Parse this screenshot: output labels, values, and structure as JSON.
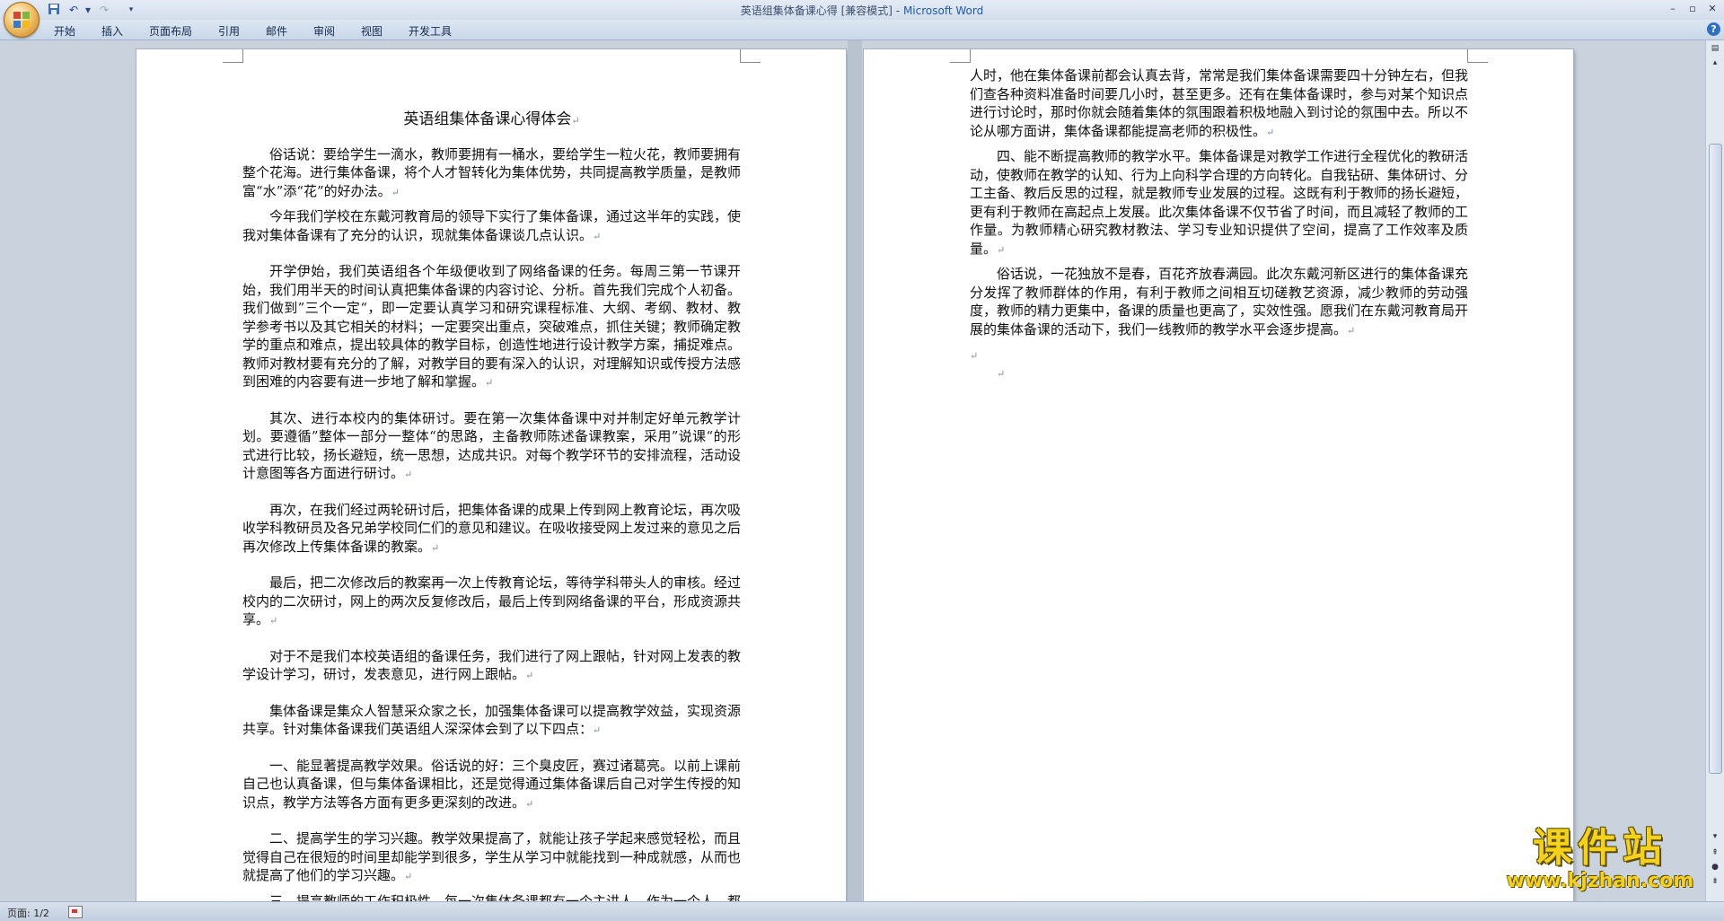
{
  "window": {
    "title": "英语组集体备课心得 [兼容模式]",
    "app_name": "Microsoft Word",
    "title_separator": " - "
  },
  "quick_access": {
    "save_icon": "save-icon",
    "undo_icon": "undo-icon",
    "redo_icon": "redo-icon",
    "customize_icon": "dropdown-icon"
  },
  "ribbon": {
    "tabs": [
      "开始",
      "插入",
      "页面布局",
      "引用",
      "邮件",
      "审阅",
      "视图",
      "开发工具"
    ]
  },
  "paragraph_mark": "↵",
  "document": {
    "title": "英语组集体备课心得体会",
    "page1": [
      "俗话说：要给学生一滴水，教师要拥有一桶水，要给学生一粒火花，教师要拥有整个花海。进行集体备课，将个人才智转化为集体优势，共同提高教学质量，是教师富“水”添“花”的好办法。",
      "今年我们学校在东戴河教育局的领导下实行了集体备课，通过这半年的实践，使我对集体备课有了充分的认识，现就集体备课谈几点认识。",
      "开学伊始，我们英语组各个年级便收到了网络备课的任务。每周三第一节课开始，我们用半天的时间认真把集体备课的内容讨论、分析。首先我们完成个人初备。我们做到”三个一定“，即一定要认真学习和研究课程标准、大纲、考纲、教材、教学参考书以及其它相关的材料；一定要突出重点，突破难点，抓住关键；教师确定教学的重点和难点，提出较具体的教学目标，创造性地进行设计教学方案，捕捉难点。教师对教材要有充分的了解，对教学目的要有深入的认识，对理解知识或传授方法感到困难的内容要有进一步地了解和掌握。",
      "其次、进行本校内的集体研讨。要在第一次集体备课中对并制定好单元教学计划。要遵循”整体一部分一整体“的思路，主备教师陈述备课教案，采用”说课“的形式进行比较，扬长避短，统一思想，达成共识。对每个教学环节的安排流程，活动设计意图等各方面进行研讨。",
      "再次，在我们经过两轮研讨后，把集体备课的成果上传到网上教育论坛，再次吸收学科教研员及各兄弟学校同仁们的意见和建议。在吸收接受网上发过来的意见之后再次修改上传集体备课的教案。",
      "最后，把二次修改后的教案再一次上传教育论坛，等待学科带头人的审核。经过校内的二次研讨，网上的两次反复修改后，最后上传到网络备课的平台，形成资源共享。",
      "对于不是我们本校英语组的备课任务，我们进行了网上跟帖，针对网上发表的教学设计学习，研讨，发表意见，进行网上跟帖。",
      "集体备课是集众人智慧采众家之长，加强集体备课可以提高教学效益，实现资源共享。针对集体备课我们英语组人深深体会到了以下四点：",
      "一、能显著提高教学效果。俗话说的好：三个臭皮匠，赛过诸葛亮。以前上课前自己也认真备课，但与集体备课相比，还是觉得通过集体备课后自己对学生传授的知识点，教学方法等各方面有更多更深刻的改进。",
      "二、提高学生的学习兴趣。教学效果提高了，就能让孩子学起来感觉轻松，而且觉得自己在很短的时间里却能学到很多，学生从学习中就能找到一种成就感，从而也就提高了他们的学习兴趣。",
      "三、提高教师的工作积极性。每一次集体备课都有一个主讲人。作为一个人，都希望把自己最优秀的一面展现给大家。那么每一个老师当自己是主备"
    ],
    "page2": [
      "人时，他在集体备课前都会认真去背，常常是我们集体备课需要四十分钟左右，但我们查各种资料准备时间要几小时，甚至更多。还有在集体备课时，参与对某个知识点进行讨论时，那时你就会随着集体的氛围跟着积极地融入到讨论的氛围中去。所以不论从哪方面讲，集体备课都能提高老师的积极性。",
      "四、能不断提高教师的教学水平。集体备课是对教学工作进行全程优化的教研活动，使教师在教学的认知、行为上向科学合理的方向转化。自我钻研、集体研讨、分工主备、教后反思的过程，就是教师专业发展的过程。这既有利于教师的扬长避短，更有利于教师在高起点上发展。此次集体备课不仅节省了时间，而且减轻了教师的工作量。为教师精心研究教材教法、学习专业知识提供了空间，提高了工作效率及质量。",
      "俗话说，一花独放不是春，百花齐放春满园。此次东戴河新区进行的集体备课充分发挥了教师群体的作用，有利于教师之间相互切磋教艺资源，减少教师的劳动强度，教师的精力更集中，备课的质量也更高了，实效性强。愿我们在东戴河教育局开展的集体备课的活动下，我们一线教师的教学水平会逐步提高。"
    ]
  },
  "status": {
    "page_counter": "页面: 1/2"
  },
  "watermark": {
    "text": "课件站",
    "url": "www.kjzhan.com"
  },
  "colors": {
    "title_app": "#1f5aa8",
    "workspace": "#c9d2dd",
    "watermark": "#f4d11a"
  }
}
